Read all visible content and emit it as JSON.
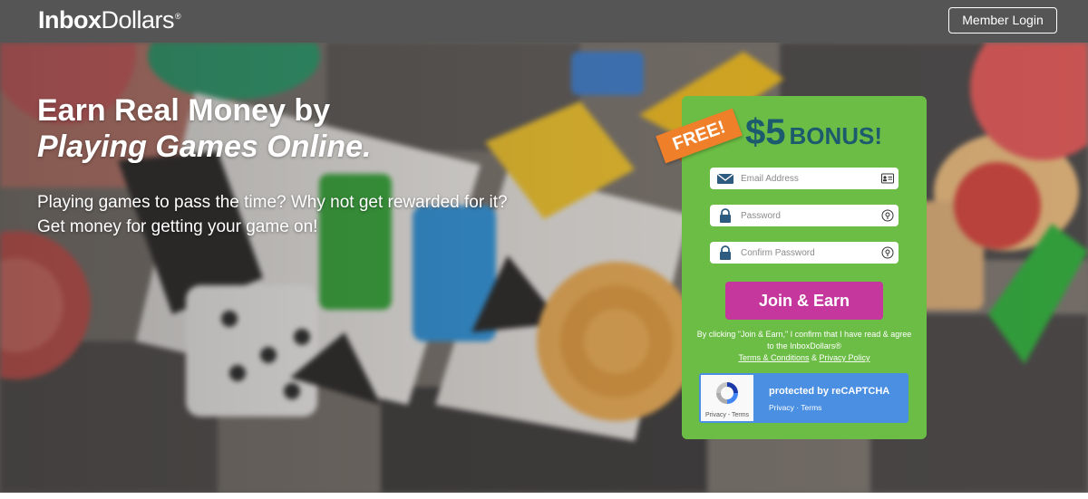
{
  "header": {
    "logo_bold": "Inbox",
    "logo_regular": "Dollars",
    "logo_mark": "®",
    "member_login": "Member Login"
  },
  "hero": {
    "headline_line1": "Earn Real Money by",
    "headline_line2": "Playing Games Online.",
    "sub_line1": "Playing games to pass the time? Why not get rewarded for it?",
    "sub_line2": "Get money for getting your game on!"
  },
  "signup": {
    "ribbon": "FREE!",
    "bonus_amount": "$5",
    "bonus_label": "BONUS!",
    "email_placeholder": "Email Address",
    "password_placeholder": "Password",
    "confirm_placeholder": "Confirm Password",
    "join_button": "Join & Earn",
    "legal_text": "By clicking \"Join & Earn,\" I confirm that I have read & agree to the InboxDollars®",
    "terms_link": "Terms & Conditions",
    "amp": "&",
    "privacy_link": "Privacy Policy"
  },
  "recaptcha": {
    "title": "protected by reCAPTCHA",
    "links": "Privacy · Terms",
    "logo_links": "Privacy - Terms"
  },
  "colors": {
    "topbar": "#555556",
    "card_green": "#6cbd45",
    "bonus_text": "#1c5a6e",
    "join_button": "#c5379c",
    "ribbon_orange": "#f07f2a",
    "recaptcha_blue": "#4a8fe2"
  },
  "icons": {
    "email_field": "envelope-icon",
    "email_right": "contact-card-icon",
    "password_field": "lock-icon",
    "password_right": "eye-icon",
    "recaptcha": "recaptcha-icon"
  }
}
